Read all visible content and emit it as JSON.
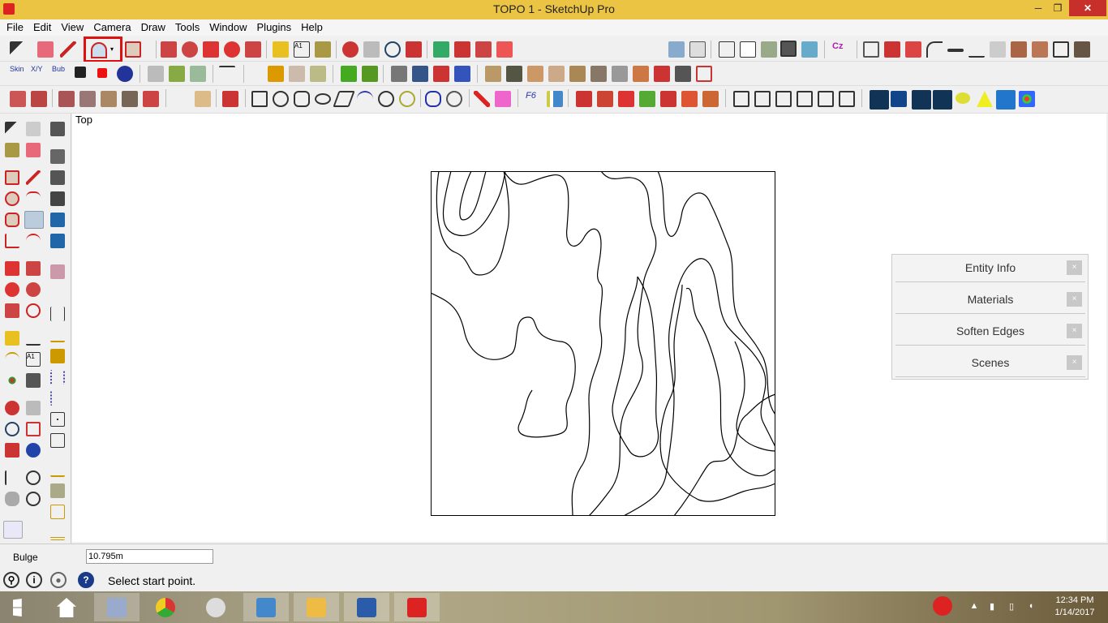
{
  "window": {
    "title": "TOPO 1 - SketchUp Pro",
    "minimize": "─",
    "maximize": "❐",
    "close": "✕"
  },
  "menu": [
    "File",
    "Edit",
    "View",
    "Camera",
    "Draw",
    "Tools",
    "Window",
    "Plugins",
    "Help"
  ],
  "toolbar": {
    "row2_labels": {
      "skin": "Skin",
      "xy": "X/Y",
      "bub": "Bub"
    },
    "row3_labels": {
      "f6": "F6"
    }
  },
  "canvas": {
    "view_label": "Top"
  },
  "tray": {
    "items": [
      {
        "label": "Entity Info",
        "close": "×"
      },
      {
        "label": "Materials",
        "close": "×"
      },
      {
        "label": "Soften Edges",
        "close": "×"
      },
      {
        "label": "Scenes",
        "close": "×"
      }
    ]
  },
  "measurements": {
    "label": "Bulge",
    "value": "10.795m"
  },
  "status": {
    "message": "Select start point.",
    "geo_icon": "⚲",
    "info_icon": "i",
    "user_icon": "●",
    "help_icon": "?"
  },
  "taskbar": {
    "apps": [
      "windows-start-icon",
      "file-explorer-home-icon",
      "pen-tablet-icon",
      "chrome-icon",
      "paint-icon",
      "photos-icon",
      "folder-icon",
      "word-icon",
      "sketchup-icon"
    ],
    "clock_time": "12:34 PM",
    "clock_date": "1/14/2017"
  },
  "colors": {
    "titlebar": "#ecc444",
    "close_button": "#c7302a",
    "highlight": "#e01010"
  }
}
